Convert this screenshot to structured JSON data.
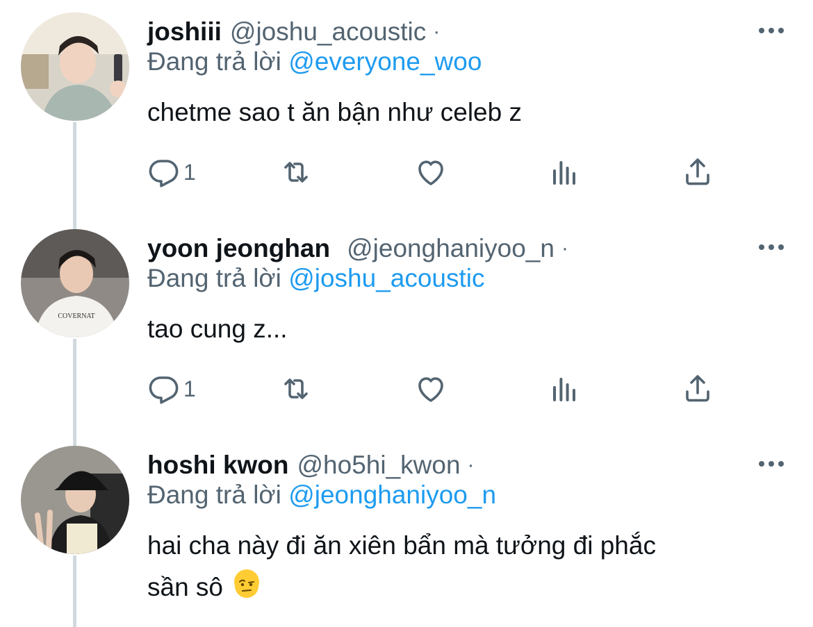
{
  "reply_prefix": "Đang trả lời",
  "tweets": [
    {
      "display_name": "joshiii",
      "handle": "@joshu_acoustic",
      "separator": "·",
      "reply_to": "@everyone_woo",
      "text": "chetme sao t ăn bận như celeb z",
      "reply_count": "1",
      "avatar": "avatar-joshiii"
    },
    {
      "display_name": "yoon jeonghan",
      "handle": "@jeonghaniyoo_n",
      "separator": "·",
      "reply_to": "@joshu_acoustic",
      "text": "tao cung z...",
      "reply_count": "1",
      "avatar": "avatar-yoon-jeonghan"
    },
    {
      "display_name": "hoshi kwon",
      "handle": "@ho5hi_kwon",
      "separator": "·",
      "reply_to": "@jeonghaniyoo_n",
      "text_line1": "hai cha này đi ăn xiên bẩn mà tưởng đi phắc",
      "text_line2": "sần sô",
      "emoji": "face-with-raised-eyebrow",
      "avatar": "avatar-hoshi-kwon"
    }
  ],
  "icons": {
    "reply": "reply-icon",
    "retweet": "retweet-icon",
    "like": "heart-icon",
    "analytics": "analytics-icon",
    "share": "share-icon",
    "more": "more-icon"
  },
  "colors": {
    "link": "#1d9bf0",
    "secondary_text": "#536471",
    "primary_text": "#0f1419",
    "thread_line": "#cfd9de"
  }
}
